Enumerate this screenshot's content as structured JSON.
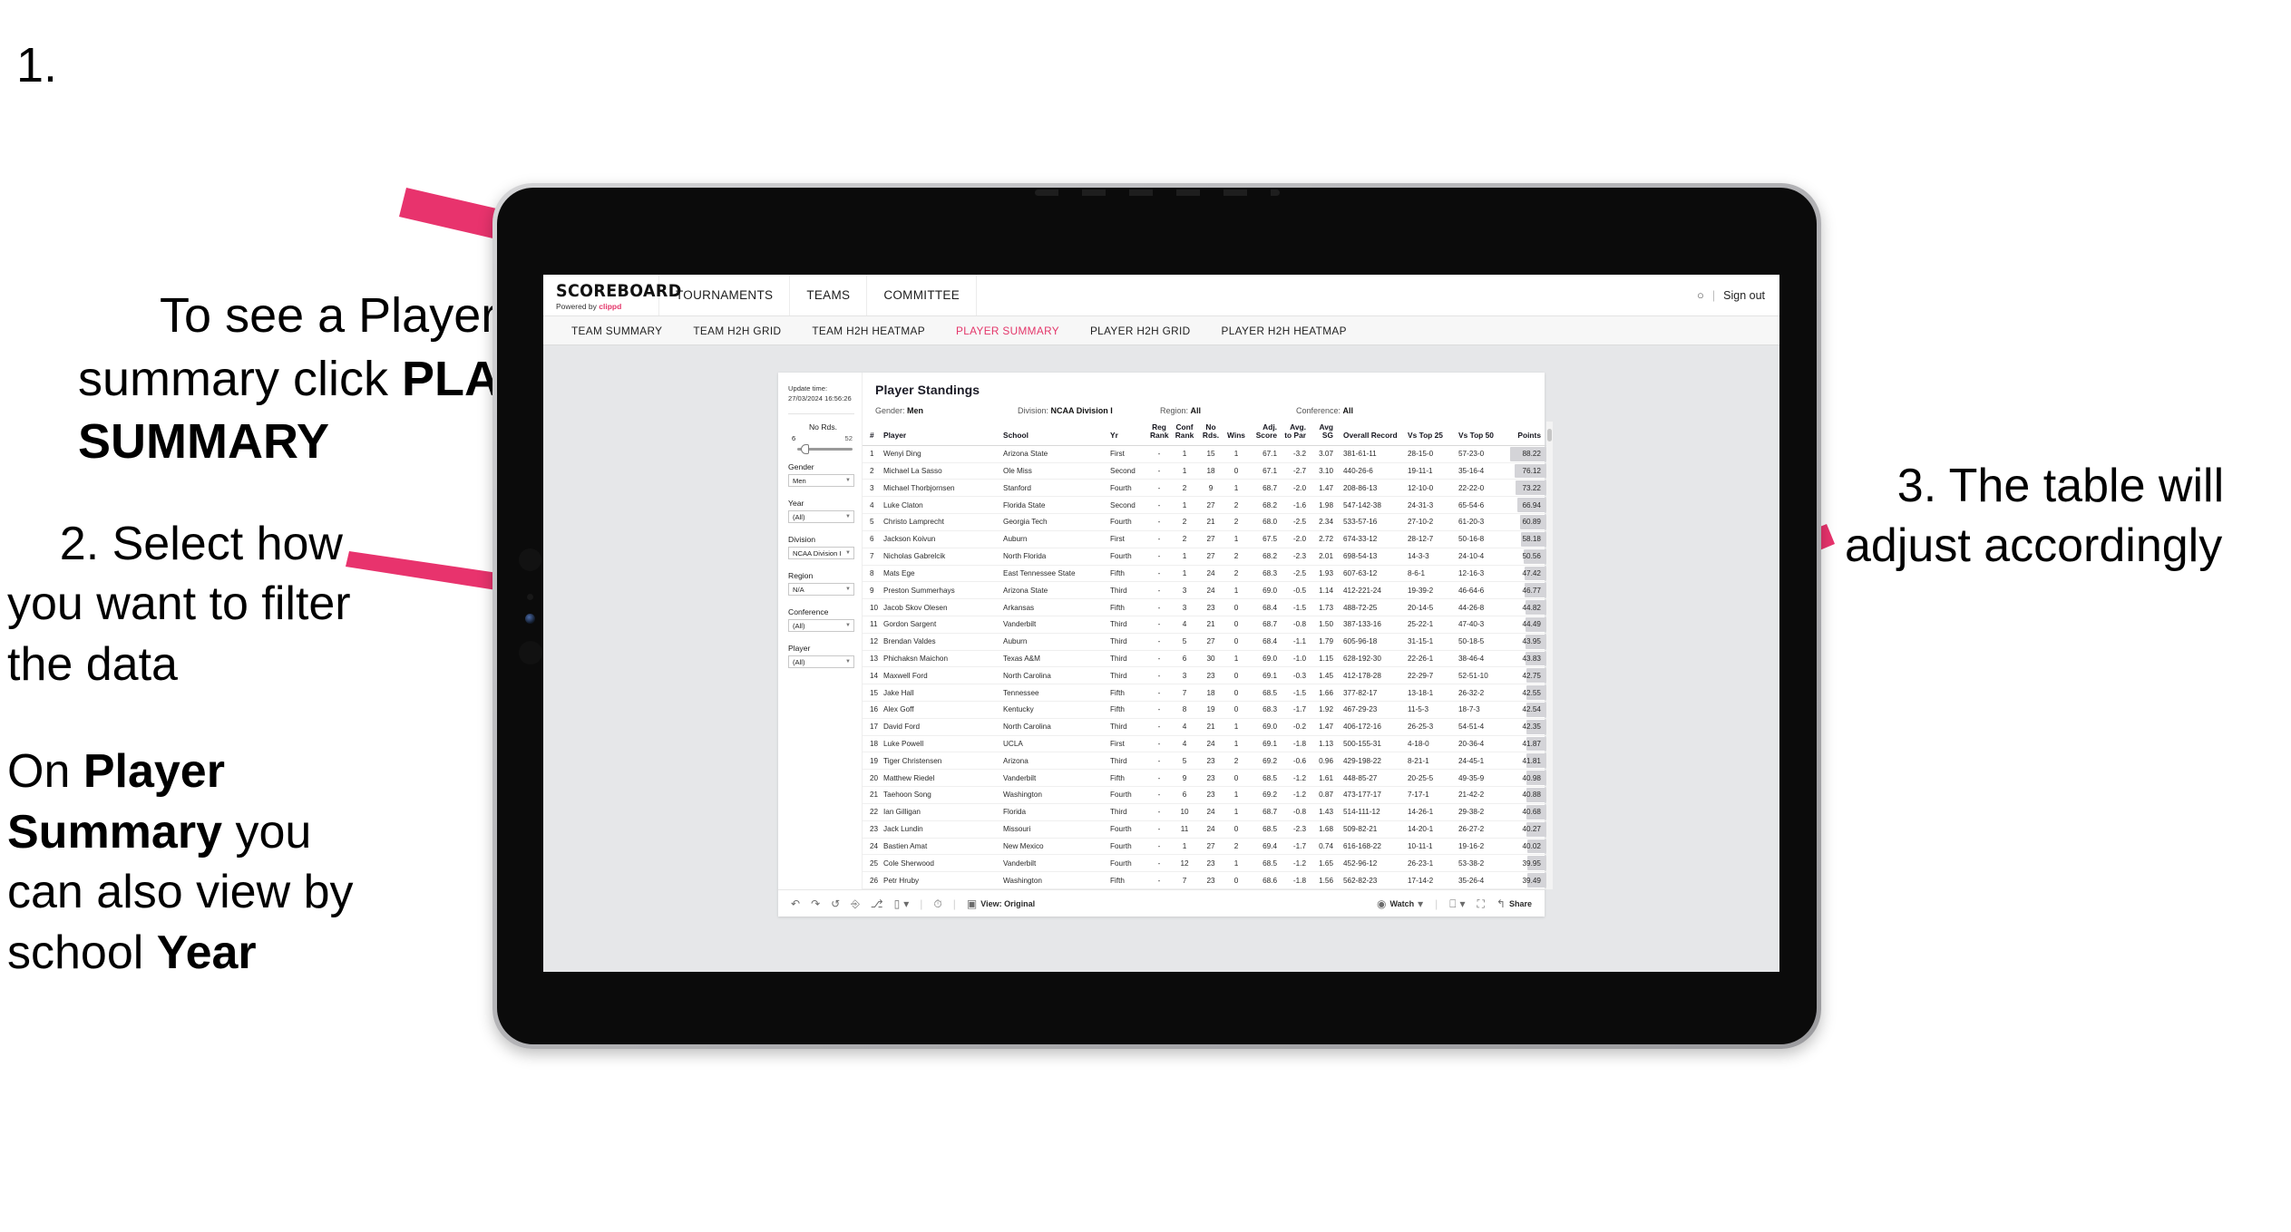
{
  "annotations": {
    "step1": {
      "number": "1.",
      "text_before": "To see a Player’s rankings summary click ",
      "text_bold": "PLAYER SUMMARY"
    },
    "step2": {
      "line1": "2. Select how you want to filter the data"
    },
    "step2b": {
      "prefix": "On ",
      "bold1": "Player Summary",
      "middle": " you can also view by school ",
      "bold2": "Year"
    },
    "step3": {
      "text": "3. The table will adjust accordingly"
    },
    "arrow_color": "#E8336D"
  },
  "app": {
    "brand": {
      "name": "SCOREBOARD",
      "powered_prefix": "Powered by ",
      "powered_brand": "clippd"
    },
    "topnav": [
      "TOURNAMENTS",
      "TEAMS",
      "COMMITTEE"
    ],
    "account": {
      "glyph": "account-icon",
      "separator": "|",
      "sign_out": "Sign out"
    },
    "subnav": [
      {
        "label": "TEAM SUMMARY",
        "active": false
      },
      {
        "label": "TEAM H2H GRID",
        "active": false
      },
      {
        "label": "TEAM H2H HEATMAP",
        "active": false
      },
      {
        "label": "PLAYER SUMMARY",
        "active": true
      },
      {
        "label": "PLAYER H2H GRID",
        "active": false
      },
      {
        "label": "PLAYER H2H HEATMAP",
        "active": false
      }
    ],
    "active_color": "#E4366A"
  },
  "filters": {
    "update_label": "Update time:",
    "update_value": "27/03/2024 16:56:26",
    "slider": {
      "label": "No Rds.",
      "min": "6",
      "max": "52",
      "value_pct": 6
    },
    "selects": [
      {
        "label": "Gender",
        "value": "Men"
      },
      {
        "label": "Year",
        "value": "(All)"
      },
      {
        "label": "Division",
        "value": "NCAA Division I"
      },
      {
        "label": "Region",
        "value": "N/A"
      },
      {
        "label": "Conference",
        "value": "(All)"
      },
      {
        "label": "Player",
        "value": "(All)"
      }
    ]
  },
  "dashboard": {
    "title": "Player Standings",
    "meta": [
      {
        "label": "Gender:",
        "value": "Men"
      },
      {
        "label": "Division:",
        "value": "NCAA Division I"
      },
      {
        "label": "Region:",
        "value": "All"
      },
      {
        "label": "Conference:",
        "value": "All"
      }
    ],
    "columns": [
      "#",
      "Player",
      "School",
      "Yr",
      "Reg Rank",
      "Conf Rank",
      "No Rds.",
      "Wins",
      "Adj. Score",
      "Avg. to Par",
      "Avg SG",
      "Overall Record",
      "Vs Top 25",
      "Vs Top 50",
      "Points"
    ],
    "rows": [
      [
        "1",
        "Wenyi Ding",
        "Arizona State",
        "First",
        "-",
        "1",
        "15",
        "1",
        "67.1",
        "-3.2",
        "3.07",
        "381-61-11",
        "28-15-0",
        "57-23-0",
        "88.22"
      ],
      [
        "2",
        "Michael La Sasso",
        "Ole Miss",
        "Second",
        "-",
        "1",
        "18",
        "0",
        "67.1",
        "-2.7",
        "3.10",
        "440-26-6",
        "19-11-1",
        "35-16-4",
        "76.12"
      ],
      [
        "3",
        "Michael Thorbjornsen",
        "Stanford",
        "Fourth",
        "-",
        "2",
        "9",
        "1",
        "68.7",
        "-2.0",
        "1.47",
        "208-86-13",
        "12-10-0",
        "22-22-0",
        "73.22"
      ],
      [
        "4",
        "Luke Claton",
        "Florida State",
        "Second",
        "-",
        "1",
        "27",
        "2",
        "68.2",
        "-1.6",
        "1.98",
        "547-142-38",
        "24-31-3",
        "65-54-6",
        "66.94"
      ],
      [
        "5",
        "Christo Lamprecht",
        "Georgia Tech",
        "Fourth",
        "-",
        "2",
        "21",
        "2",
        "68.0",
        "-2.5",
        "2.34",
        "533-57-16",
        "27-10-2",
        "61-20-3",
        "60.89"
      ],
      [
        "6",
        "Jackson Koivun",
        "Auburn",
        "First",
        "-",
        "2",
        "27",
        "1",
        "67.5",
        "-2.0",
        "2.72",
        "674-33-12",
        "28-12-7",
        "50-16-8",
        "58.18"
      ],
      [
        "7",
        "Nicholas Gabrelcik",
        "North Florida",
        "Fourth",
        "-",
        "1",
        "27",
        "2",
        "68.2",
        "-2.3",
        "2.01",
        "698-54-13",
        "14-3-3",
        "24-10-4",
        "50.56"
      ],
      [
        "8",
        "Mats Ege",
        "East Tennessee State",
        "Fifth",
        "-",
        "1",
        "24",
        "2",
        "68.3",
        "-2.5",
        "1.93",
        "607-63-12",
        "8-6-1",
        "12-16-3",
        "47.42"
      ],
      [
        "9",
        "Preston Summerhays",
        "Arizona State",
        "Third",
        "-",
        "3",
        "24",
        "1",
        "69.0",
        "-0.5",
        "1.14",
        "412-221-24",
        "19-39-2",
        "46-64-6",
        "46.77"
      ],
      [
        "10",
        "Jacob Skov Olesen",
        "Arkansas",
        "Fifth",
        "-",
        "3",
        "23",
        "0",
        "68.4",
        "-1.5",
        "1.73",
        "488-72-25",
        "20-14-5",
        "44-26-8",
        "44.82"
      ],
      [
        "11",
        "Gordon Sargent",
        "Vanderbilt",
        "Third",
        "-",
        "4",
        "21",
        "0",
        "68.7",
        "-0.8",
        "1.50",
        "387-133-16",
        "25-22-1",
        "47-40-3",
        "44.49"
      ],
      [
        "12",
        "Brendan Valdes",
        "Auburn",
        "Third",
        "-",
        "5",
        "27",
        "0",
        "68.4",
        "-1.1",
        "1.79",
        "605-96-18",
        "31-15-1",
        "50-18-5",
        "43.95"
      ],
      [
        "13",
        "Phichaksn Maichon",
        "Texas A&M",
        "Third",
        "-",
        "6",
        "30",
        "1",
        "69.0",
        "-1.0",
        "1.15",
        "628-192-30",
        "22-26-1",
        "38-46-4",
        "43.83"
      ],
      [
        "14",
        "Maxwell Ford",
        "North Carolina",
        "Third",
        "-",
        "3",
        "23",
        "0",
        "69.1",
        "-0.3",
        "1.45",
        "412-178-28",
        "22-29-7",
        "52-51-10",
        "42.75"
      ],
      [
        "15",
        "Jake Hall",
        "Tennessee",
        "Fifth",
        "-",
        "7",
        "18",
        "0",
        "68.5",
        "-1.5",
        "1.66",
        "377-82-17",
        "13-18-1",
        "26-32-2",
        "42.55"
      ],
      [
        "16",
        "Alex Goff",
        "Kentucky",
        "Fifth",
        "-",
        "8",
        "19",
        "0",
        "68.3",
        "-1.7",
        "1.92",
        "467-29-23",
        "11-5-3",
        "18-7-3",
        "42.54"
      ],
      [
        "17",
        "David Ford",
        "North Carolina",
        "Third",
        "-",
        "4",
        "21",
        "1",
        "69.0",
        "-0.2",
        "1.47",
        "406-172-16",
        "26-25-3",
        "54-51-4",
        "42.35"
      ],
      [
        "18",
        "Luke Powell",
        "UCLA",
        "First",
        "-",
        "4",
        "24",
        "1",
        "69.1",
        "-1.8",
        "1.13",
        "500-155-31",
        "4-18-0",
        "20-36-4",
        "41.87"
      ],
      [
        "19",
        "Tiger Christensen",
        "Arizona",
        "Third",
        "-",
        "5",
        "23",
        "2",
        "69.2",
        "-0.6",
        "0.96",
        "429-198-22",
        "8-21-1",
        "24-45-1",
        "41.81"
      ],
      [
        "20",
        "Matthew Riedel",
        "Vanderbilt",
        "Fifth",
        "-",
        "9",
        "23",
        "0",
        "68.5",
        "-1.2",
        "1.61",
        "448-85-27",
        "20-25-5",
        "49-35-9",
        "40.98"
      ],
      [
        "21",
        "Taehoon Song",
        "Washington",
        "Fourth",
        "-",
        "6",
        "23",
        "1",
        "69.2",
        "-1.2",
        "0.87",
        "473-177-17",
        "7-17-1",
        "21-42-2",
        "40.88"
      ],
      [
        "22",
        "Ian Gilligan",
        "Florida",
        "Third",
        "-",
        "10",
        "24",
        "1",
        "68.7",
        "-0.8",
        "1.43",
        "514-111-12",
        "14-26-1",
        "29-38-2",
        "40.68"
      ],
      [
        "23",
        "Jack Lundin",
        "Missouri",
        "Fourth",
        "-",
        "11",
        "24",
        "0",
        "68.5",
        "-2.3",
        "1.68",
        "509-82-21",
        "14-20-1",
        "26-27-2",
        "40.27"
      ],
      [
        "24",
        "Bastien Amat",
        "New Mexico",
        "Fourth",
        "-",
        "1",
        "27",
        "2",
        "69.4",
        "-1.7",
        "0.74",
        "616-168-22",
        "10-11-1",
        "19-16-2",
        "40.02"
      ],
      [
        "25",
        "Cole Sherwood",
        "Vanderbilt",
        "Fourth",
        "-",
        "12",
        "23",
        "1",
        "68.5",
        "-1.2",
        "1.65",
        "452-96-12",
        "26-23-1",
        "53-38-2",
        "39.95"
      ],
      [
        "26",
        "Petr Hruby",
        "Washington",
        "Fifth",
        "-",
        "7",
        "23",
        "0",
        "68.6",
        "-1.8",
        "1.56",
        "562-82-23",
        "17-14-2",
        "35-26-4",
        "39.49"
      ]
    ]
  },
  "toolbar": {
    "left_icons": [
      "undo-icon",
      "redo-icon",
      "revert-icon",
      "refresh-icon",
      "pause-icon",
      "device-icon"
    ],
    "caret": "▾",
    "clock_icon": "clock-icon",
    "view_icon": "view-icon",
    "view_label": "View: Original",
    "watch_icon": "eye-icon",
    "watch_label": "Watch",
    "download_icon": "download-icon",
    "fullscreen_icon": "fullscreen-icon",
    "share_icon": "share-icon",
    "share_label": "Share"
  }
}
